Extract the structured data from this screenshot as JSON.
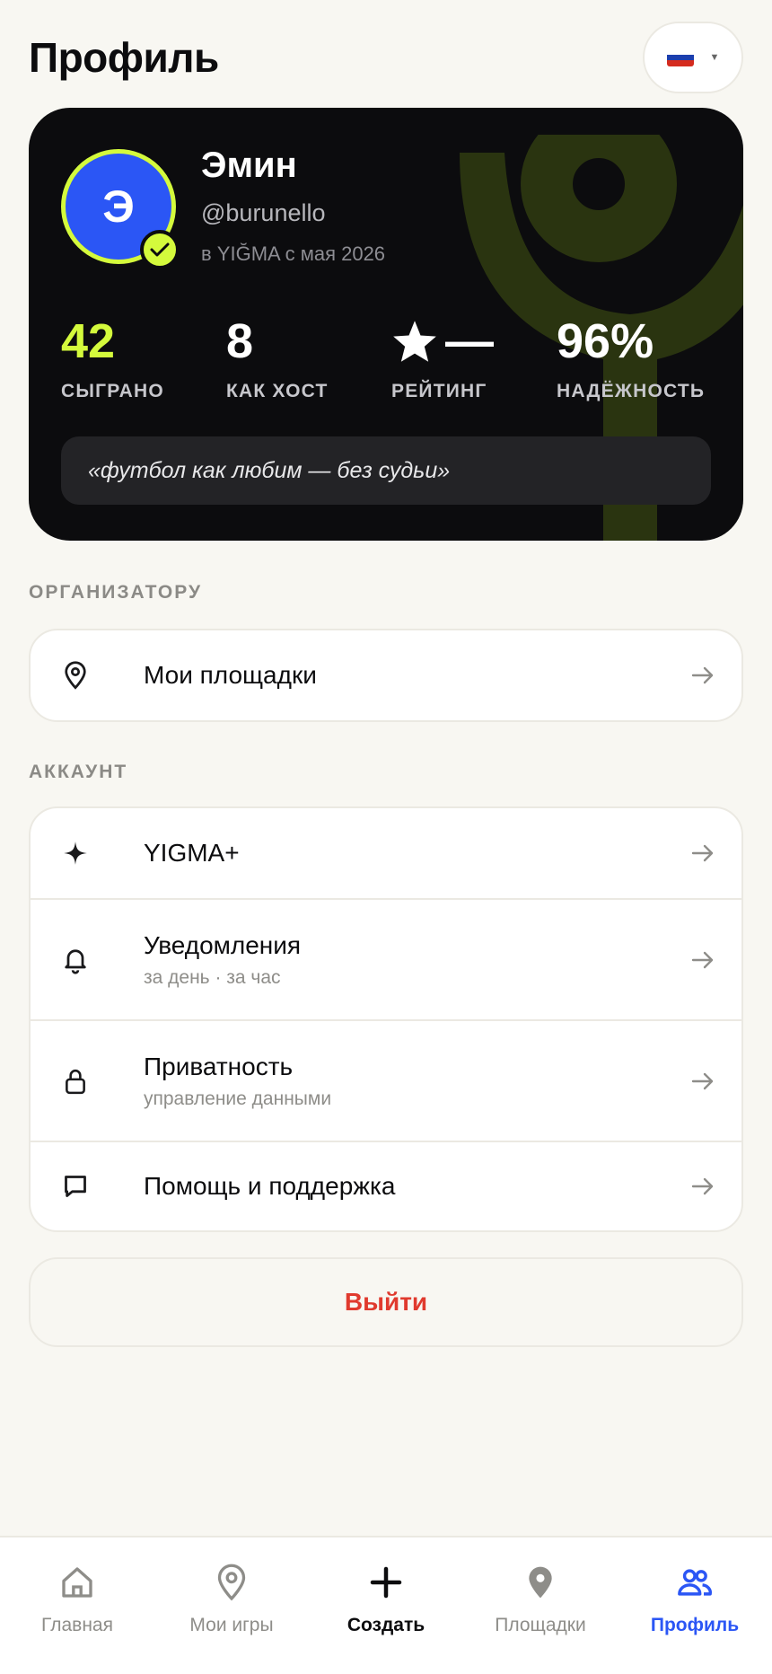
{
  "header": {
    "title": "Профиль",
    "language": {
      "flag_icon": "russia-flag-icon",
      "flag_colors": [
        "#ffffff",
        "#1c3fae",
        "#d52b1e"
      ]
    }
  },
  "profile": {
    "avatar_letter": "Э",
    "name": "Эмин",
    "handle": "@burunello",
    "member_since": "в YIĞMA с мая 2026",
    "stats": [
      {
        "value": "42",
        "label": "СЫГРАНО",
        "color": "#d4fa3c"
      },
      {
        "value": "8",
        "label": "КАК ХОСТ",
        "color": "#ffffff"
      },
      {
        "value": "—",
        "label": "РЕЙТИНГ",
        "color": "#ffffff",
        "icon": "star-icon"
      },
      {
        "value": "96%",
        "label": "НАДЁЖНОСТЬ",
        "color": "#ffffff"
      }
    ],
    "bio": "«футбол как любим — без судьи»"
  },
  "sections": {
    "organizer": {
      "label": "ОРГАНИЗАТОРУ",
      "items": [
        {
          "title": "Мои площадки",
          "icon": "location-pin-icon"
        }
      ]
    },
    "account": {
      "label": "АККАУНТ",
      "items": [
        {
          "title": "YIGMA+",
          "icon": "sparkle-icon"
        },
        {
          "title": "Уведомления",
          "subtitle": "за день · за час",
          "icon": "bell-icon"
        },
        {
          "title": "Приватность",
          "subtitle": "управление данными",
          "icon": "lock-icon"
        },
        {
          "title": "Помощь и поддержка",
          "icon": "chat-bubble-icon"
        }
      ]
    }
  },
  "logout_label": "Выйти",
  "tabbar": {
    "items": [
      {
        "label": "Главная",
        "icon": "home-icon"
      },
      {
        "label": "Мои игры",
        "icon": "location-pin-icon"
      },
      {
        "label": "Создать",
        "icon": "plus-icon"
      },
      {
        "label": "Площадки",
        "icon": "map-pin-filled-icon"
      },
      {
        "label": "Профиль",
        "icon": "users-icon",
        "active": true
      }
    ]
  },
  "colors": {
    "accent_lime": "#d4fa3c",
    "accent_blue": "#2b56f5",
    "danger": "#e03a2e",
    "background": "#f8f7f2",
    "card_dark": "#0c0c0e"
  }
}
